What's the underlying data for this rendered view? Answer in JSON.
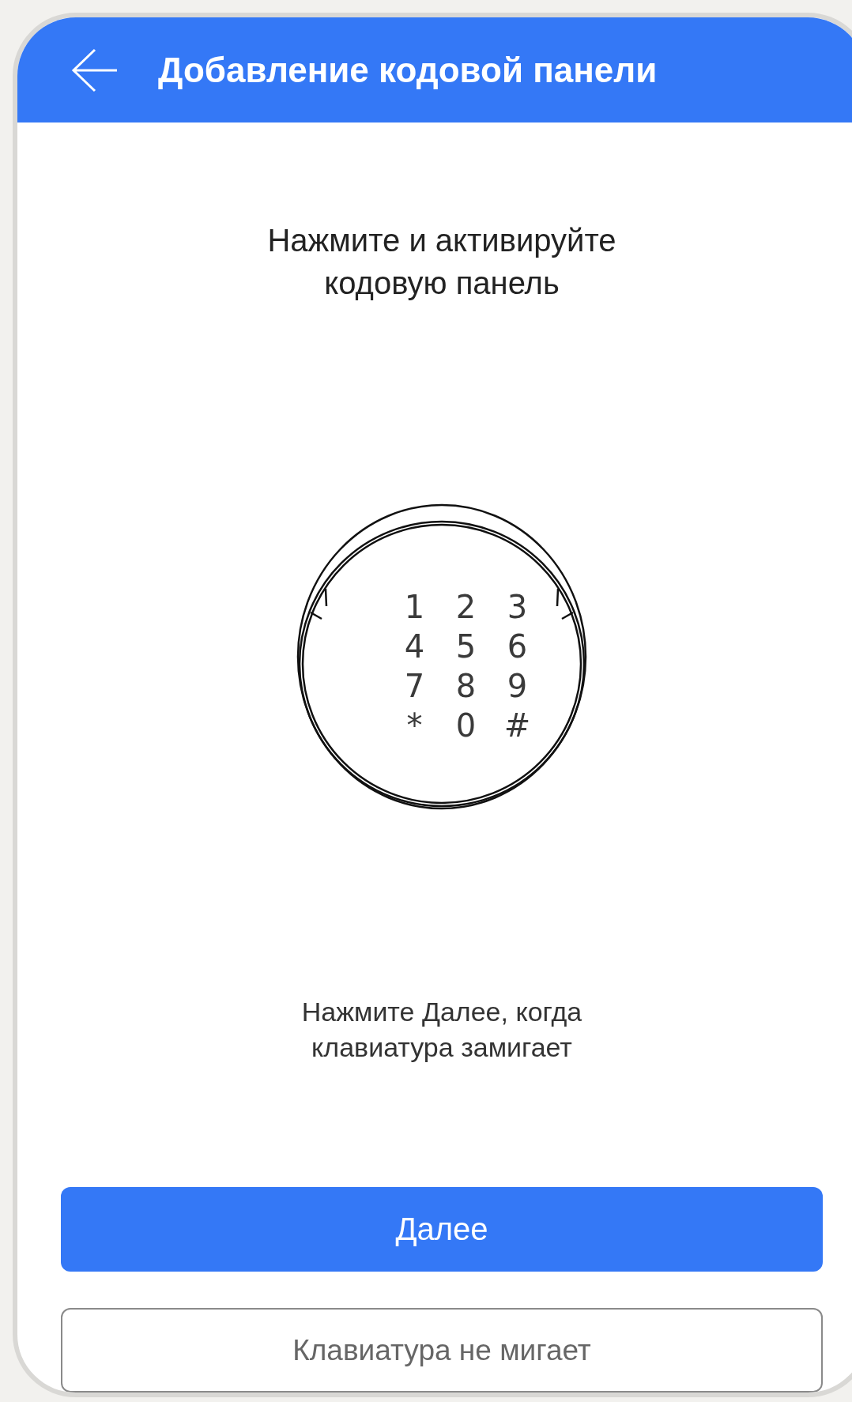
{
  "header": {
    "title": "Добавление кодовой панели"
  },
  "instruction": [
    "Нажмите и активируйте",
    "кодовую панель"
  ],
  "keypad": {
    "keys": [
      "1",
      "2",
      "3",
      "4",
      "5",
      "6",
      "7",
      "8",
      "9",
      "*",
      "0",
      "#"
    ]
  },
  "hint": [
    "Нажмите Далее, когда",
    "клавиатура замигает"
  ],
  "buttons": [
    {
      "kind": "primary",
      "label": "Далее"
    },
    {
      "kind": "outline",
      "label": "Клавиатура не мигает"
    }
  ]
}
